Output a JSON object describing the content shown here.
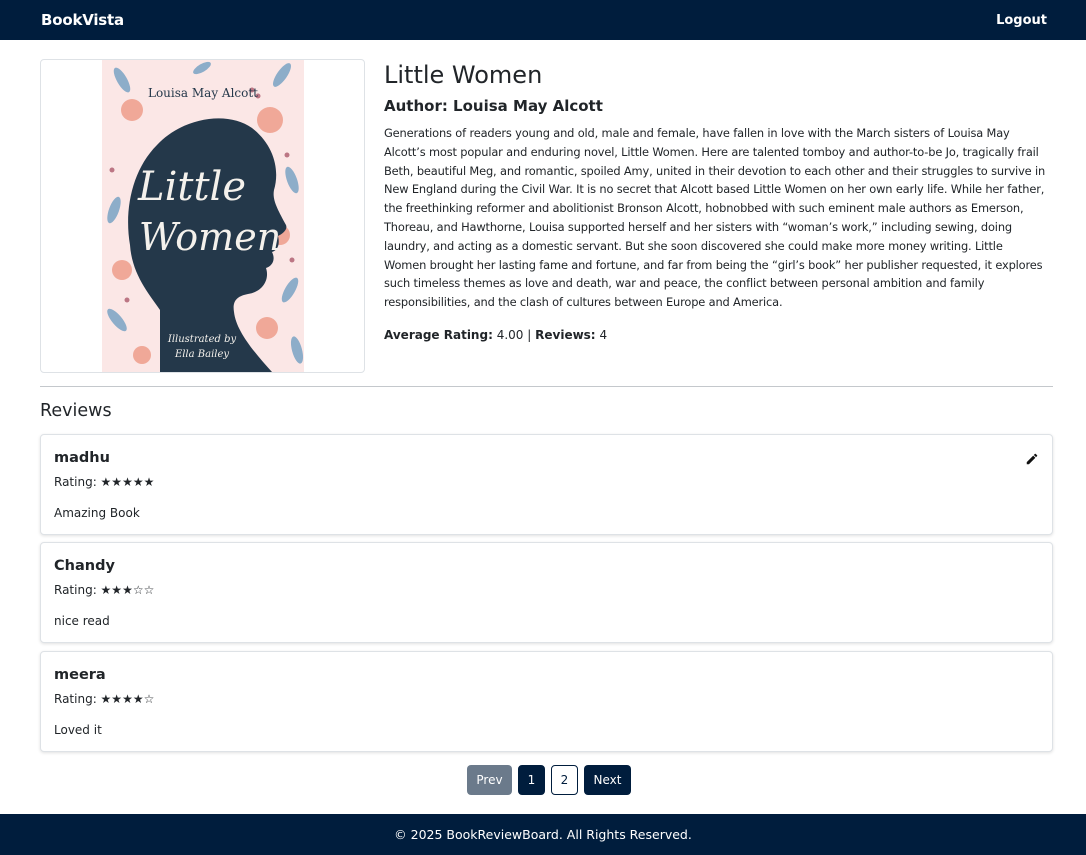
{
  "navbar": {
    "brand": "BookVista",
    "logout_label": "Logout"
  },
  "book": {
    "title": "Little Women",
    "author_label": "Author: Louisa May Alcott",
    "cover": {
      "author_text": "Louisa May Alcott",
      "title_line1": "Little",
      "title_line2": "Women",
      "illustrated_line1": "Illustrated by",
      "illustrated_line2": "Ella Bailey"
    },
    "description": "Generations of readers young and old, male and female, have fallen in love with the March sisters of Louisa May Alcott’s most popular and enduring novel, Little Women. Here are talented tomboy and author-to-be Jo, tragically frail Beth, beautiful Meg, and romantic, spoiled Amy, united in their devotion to each other and their struggles to survive in New England during the Civil War. It is no secret that Alcott based Little Women on her own early life. While her father, the freethinking reformer and abolitionist Bronson Alcott, hobnobbed with such eminent male authors as Emerson, Thoreau, and Hawthorne, Louisa supported herself and her sisters with “woman’s work,” including sewing, doing laundry, and acting as a domestic servant. But she soon discovered she could make more money writing. Little Women brought her lasting fame and fortune, and far from being the “girl’s book” her publisher requested, it explores such timeless themes as love and death, war and peace, the conflict between personal ambition and family responsibilities, and the clash of cultures between Europe and America.",
    "average_rating_label": "Average Rating:",
    "average_rating_value": "4.00",
    "separator": "|",
    "reviews_label": "Reviews:",
    "reviews_count": "4"
  },
  "reviews": {
    "heading": "Reviews",
    "items": [
      {
        "user": "madhu",
        "rating": "Rating: ★★★★★",
        "text": "Amazing Book",
        "editable": true,
        "icon": "pencil-icon"
      },
      {
        "user": "Chandy",
        "rating": "Rating: ★★★☆☆",
        "text": "nice read",
        "editable": false
      },
      {
        "user": "meera",
        "rating": "Rating: ★★★★☆",
        "text": "Loved it",
        "editable": false
      }
    ]
  },
  "pagination": {
    "prev_label": "Prev",
    "pages": [
      "1",
      "2"
    ],
    "current_page": "1",
    "next_label": "Next"
  },
  "footer": {
    "text": "© 2025 BookReviewBoard. All Rights Reserved."
  },
  "colors": {
    "navy": "#001d3d",
    "prev_button": "#6b7a8b",
    "cover_background": "#fbe7e6",
    "silhouette": "#24384a"
  }
}
